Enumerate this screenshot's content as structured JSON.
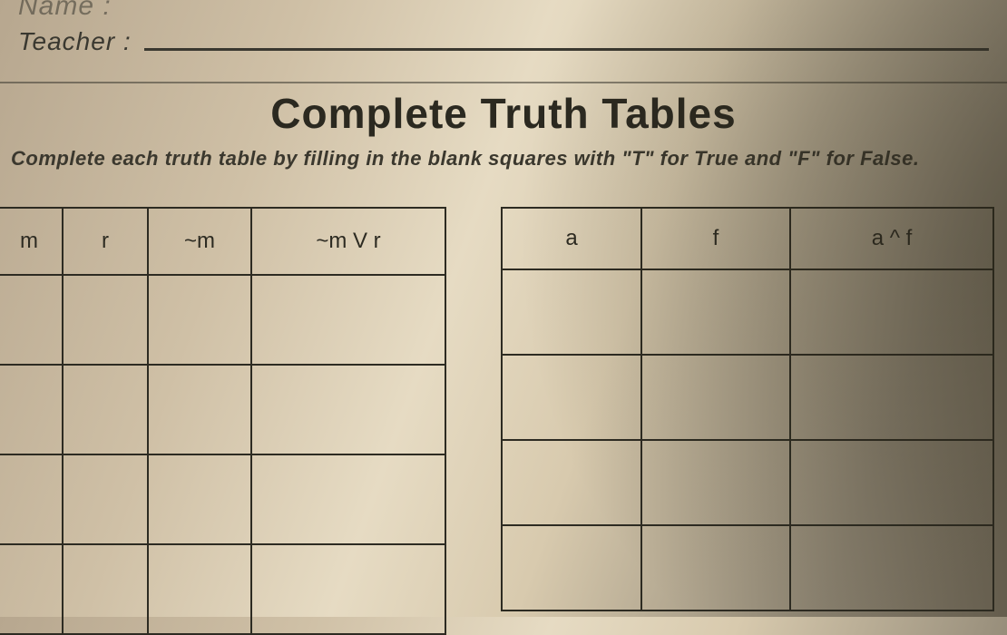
{
  "form": {
    "name_label": "Name :",
    "teacher_label": "Teacher :"
  },
  "title": "Complete Truth Tables",
  "instructions": "Complete each truth table by filling in the blank squares with \"T\" for True and \"F\" for False.",
  "table_left": {
    "headers": [
      "m",
      "r",
      "~m",
      "~m V r"
    ],
    "rows": [
      [
        "",
        "",
        "",
        ""
      ],
      [
        "",
        "",
        "",
        ""
      ],
      [
        "",
        "",
        "",
        ""
      ],
      [
        "",
        "",
        "",
        ""
      ]
    ]
  },
  "table_right": {
    "headers": [
      "a",
      "f",
      "a ^ f"
    ],
    "rows": [
      [
        "",
        "",
        ""
      ],
      [
        "",
        "",
        ""
      ],
      [
        "",
        "",
        ""
      ],
      [
        "",
        "",
        ""
      ]
    ]
  }
}
